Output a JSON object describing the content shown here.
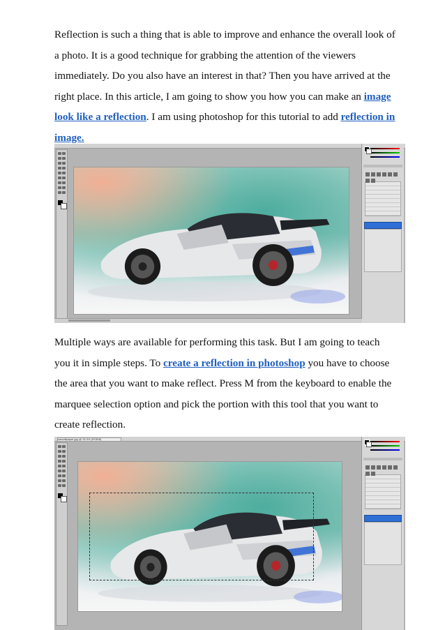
{
  "article": {
    "p1": {
      "t1": "Reflection is such a thing that is able to improve and enhance the overall look of a photo. It is a good technique for grabbing the attention of the viewers immediately. Do you also have an interest in that? Then you have arrived at the right place. In this article, I am going to show you how you can make an ",
      "link1": "image look like a reflection",
      "t2": ". I am using photoshop for this tutorial to add ",
      "link2": "reflection in image.",
      "t3": ""
    },
    "p2": {
      "t1": "Multiple ways are available for performing this task.  But I am going to teach you it in simple steps. To ",
      "link1": "create a reflection in photoshop",
      "t2": " you have to choose the area that you want to make reflect. Press M from the keyboard to enable the marquee selection option and pick the portion with this tool that you want to create reflection."
    }
  },
  "screenshots": [
    {
      "name": "photoshop-window-car",
      "has_selection": false
    },
    {
      "name": "photoshop-window-car-with-marquee",
      "has_selection": true,
      "tab_label": "carwallpaper.jpg @ 33.3% (RGB/8)"
    }
  ],
  "colors": {
    "link": "#1f5fbf",
    "workspace": "#b4b4b4",
    "layer_selected": "#2f6fd6"
  }
}
